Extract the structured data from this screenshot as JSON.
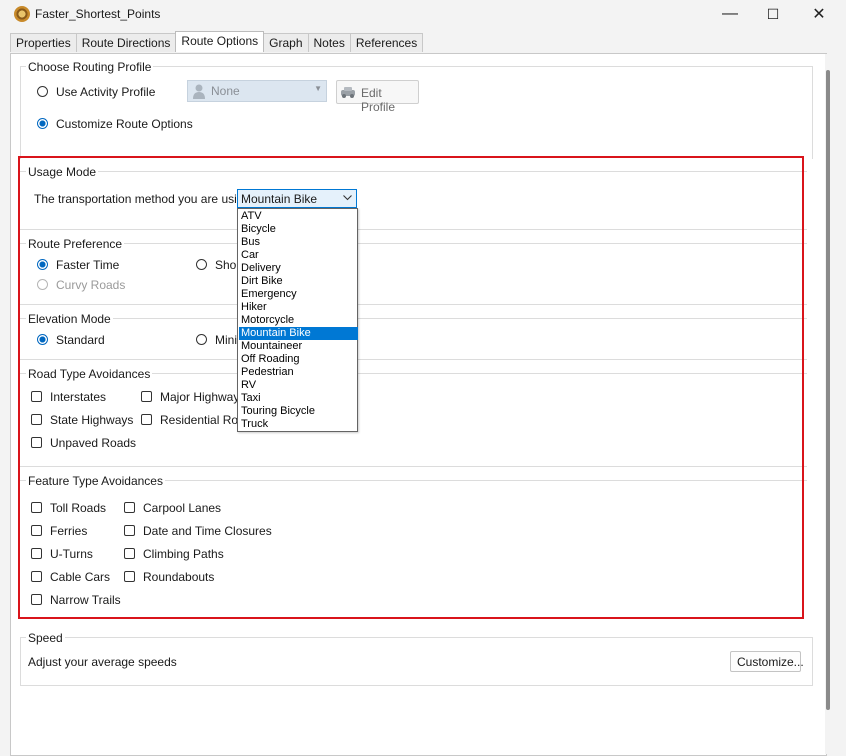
{
  "window": {
    "title": "Faster_Shortest_Points",
    "minimize": "—",
    "maximize": "☐",
    "close": "✕"
  },
  "tabs": [
    "Properties",
    "Route Directions",
    "Route Options",
    "Graph",
    "Notes",
    "References"
  ],
  "routing_profile": {
    "legend": "Choose Routing Profile",
    "use_activity_profile": "Use Activity Profile",
    "profile_value": "None",
    "edit_profile": "Edit Profile",
    "customize_route_options": "Customize Route Options"
  },
  "usage_mode": {
    "legend": "Usage Mode",
    "prompt": "The transportation method you are using:",
    "selected": "Mountain Bike",
    "options": [
      "ATV",
      "Bicycle",
      "Bus",
      "Car",
      "Delivery",
      "Dirt Bike",
      "Emergency",
      "Hiker",
      "Motorcycle",
      "Mountain Bike",
      "Mountaineer",
      "Off Roading",
      "Pedestrian",
      "RV",
      "Taxi",
      "Touring Bicycle",
      "Truck"
    ]
  },
  "route_preference": {
    "legend": "Route Preference",
    "faster_time": "Faster Time",
    "shorter_distance": "Shor",
    "curvy_roads": "Curvy Roads"
  },
  "elevation_mode": {
    "legend": "Elevation Mode",
    "standard": "Standard",
    "minimize": "Mini"
  },
  "road_type": {
    "legend": "Road Type Avoidances",
    "interstates": "Interstates",
    "major_highways": "Major Highways",
    "state_highways": "State Highways",
    "residential_roads": "Residential Road",
    "unpaved_roads": "Unpaved Roads"
  },
  "feature_type": {
    "legend": "Feature Type Avoidances",
    "toll_roads": "Toll Roads",
    "carpool_lanes": "Carpool Lanes",
    "ferries": "Ferries",
    "date_time_closures": "Date and Time Closures",
    "u_turns": "U-Turns",
    "climbing_paths": "Climbing Paths",
    "cable_cars": "Cable Cars",
    "roundabouts": "Roundabouts",
    "narrow_trails": "Narrow Trails"
  },
  "speed": {
    "legend": "Speed",
    "description": "Adjust your average speeds",
    "customize": "Customize..."
  }
}
